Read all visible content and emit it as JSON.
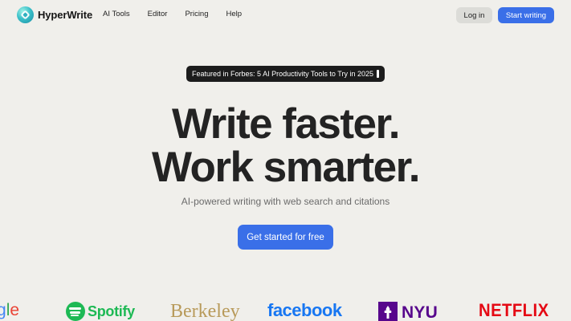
{
  "brand": {
    "name": "HyperWrite",
    "icon": "hyperwrite-logo-icon",
    "accent": "#3a6fe8"
  },
  "nav": {
    "links": [
      {
        "label": "AI Tools"
      },
      {
        "label": "Editor"
      },
      {
        "label": "Pricing"
      },
      {
        "label": "Help"
      }
    ],
    "login_label": "Log in",
    "start_label": "Start writing"
  },
  "hero": {
    "badge_text": "Featured in Forbes: 5 AI Productivity Tools to Try in 2025",
    "headline_line1": "Write faster.",
    "headline_line2": "Work smarter.",
    "subtitle": "AI-powered writing with web search and citations",
    "cta_label": "Get started for free"
  },
  "logos": {
    "google_partial": [
      "g",
      "l",
      "e"
    ],
    "spotify": "Spotify",
    "berkeley": "Berkeley",
    "facebook": "facebook",
    "nyu": "NYU",
    "netflix": "NETFLIX"
  }
}
